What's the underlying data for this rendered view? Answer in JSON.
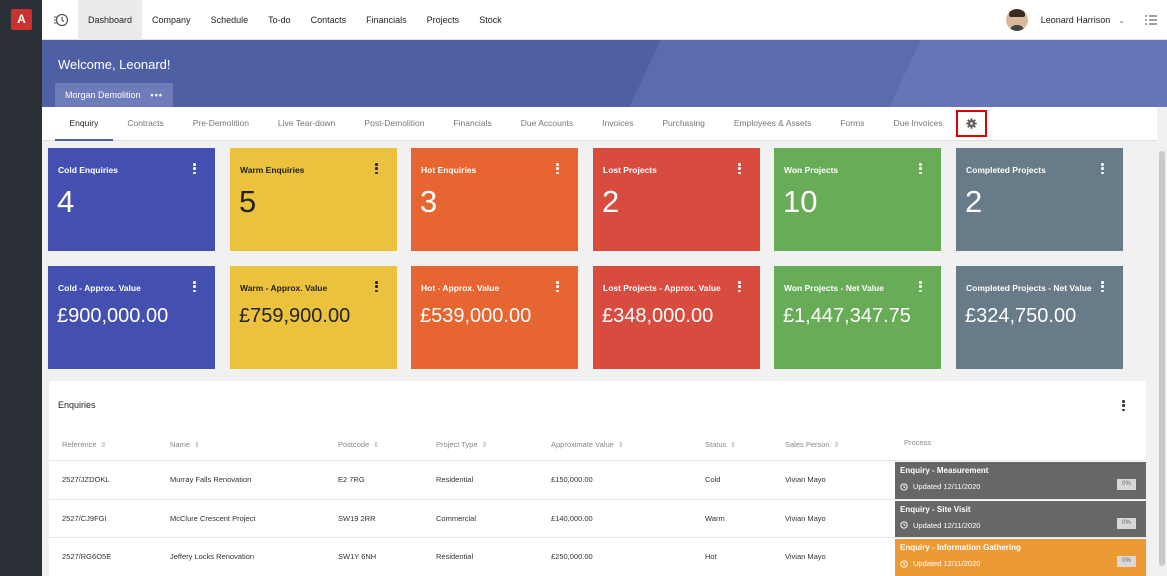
{
  "app": {
    "logo_letter": "A"
  },
  "nav": {
    "items": [
      "Dashboard",
      "Company",
      "Schedule",
      "To-do",
      "Contacts",
      "Financials",
      "Projects",
      "Stock"
    ],
    "user_name": "Leonard Harrison"
  },
  "banner": {
    "welcome": "Welcome, Leonard!",
    "company": "Morgan Demolition"
  },
  "subtabs": [
    "Enquiry",
    "Contracts",
    "Pre-Demolition",
    "Live Tear-down",
    "Post-Demolition",
    "Financials",
    "Due Accounts",
    "Invoices",
    "Purchasing",
    "Employees & Assets",
    "Forms",
    "Due Invoices"
  ],
  "cards_row1": [
    {
      "title": "Cold Enquiries",
      "value": "4",
      "color": "#4350b0"
    },
    {
      "title": "Warm Enquiries",
      "value": "5",
      "color": "#ebc23d"
    },
    {
      "title": "Hot Enquiries",
      "value": "3",
      "color": "#e66531"
    },
    {
      "title": "Lost Projects",
      "value": "2",
      "color": "#d84b3f"
    },
    {
      "title": "Won Projects",
      "value": "10",
      "color": "#68ac58"
    },
    {
      "title": "Completed Projects",
      "value": "2",
      "color": "#677b88"
    }
  ],
  "cards_row2": [
    {
      "title": "Cold - Approx. Value",
      "value": "£900,000.00",
      "color": "#4350b0"
    },
    {
      "title": "Warm - Approx. Value",
      "value": "£759,900.00",
      "color": "#ebc23d"
    },
    {
      "title": "Hot - Approx. Value",
      "value": "£539,000.00",
      "color": "#e66531"
    },
    {
      "title": "Lost Projects - Approx. Value",
      "value": "£348,000.00",
      "color": "#d84b3f"
    },
    {
      "title": "Won Projects - Net Value",
      "value": "£1,447,347.75",
      "color": "#68ac58"
    },
    {
      "title": "Completed Projects - Net Value",
      "value": "£324,750.00",
      "color": "#677b88"
    }
  ],
  "enquiries": {
    "title": "Enquiries",
    "columns": [
      "Reference",
      "Name",
      "Postcode",
      "Project Type",
      "Approximate Value",
      "Status",
      "Sales Person",
      "Process"
    ],
    "rows": [
      {
        "reference": "2527/JZDOKL",
        "name": "Murray Falls Renovation",
        "postcode": "E2 7RG",
        "type": "Residential",
        "value": "£150,000.00",
        "status": "Cold",
        "sales": "Vivian Mayo",
        "process": "Enquiry - Measurement",
        "updated": "Updated 12/11/2020",
        "pct": "0%",
        "process_color": "#676767"
      },
      {
        "reference": "2527/CJ9FGI",
        "name": "McClure Crescent Project",
        "postcode": "SW19 2RR",
        "type": "Commercial",
        "value": "£140,000.00",
        "status": "Warm",
        "sales": "Vivian Mayo",
        "process": "Enquiry - Site Visit",
        "updated": "Updated 12/11/2020",
        "pct": "0%",
        "process_color": "#676767"
      },
      {
        "reference": "2527/RG6O5E",
        "name": "Jeffery Locks Renovation",
        "postcode": "SW1Y 6NH",
        "type": "Residential",
        "value": "£250,000.00",
        "status": "Hot",
        "sales": "Vivian Mayo",
        "process": "Enquiry - Information Gathering",
        "updated": "Updated 12/11/2020",
        "pct": "0%",
        "process_color": "#ec9a35"
      }
    ]
  }
}
